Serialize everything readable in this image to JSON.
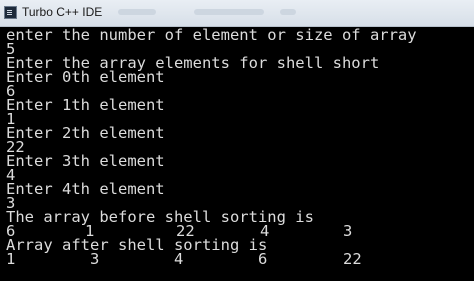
{
  "window": {
    "title": "Turbo C++ IDE"
  },
  "console": {
    "lines": [
      "enter the number of element or size of array",
      "5",
      "Enter the array elements for shell short",
      "Enter 0th element",
      "6",
      "Enter 1th element",
      "1",
      "Enter 2th element",
      "22",
      "Enter 3th element",
      "4",
      "Enter 4th element",
      "3",
      "The array before shell sorting is",
      "Array after shell sorting is"
    ],
    "before_values": [
      "6",
      "1",
      "22",
      "4",
      "3"
    ],
    "after_values": [
      "1",
      "3",
      "4",
      "6",
      "22"
    ]
  }
}
